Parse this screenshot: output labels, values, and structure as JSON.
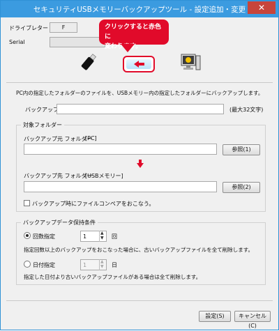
{
  "window": {
    "title": "セキュリティUSBメモリーバックアップツール - 設定追加・変更",
    "close": "✕"
  },
  "top": {
    "drive_letter_label": "ドライブレター",
    "drive_letter_value": "F",
    "serial_label": "Serial"
  },
  "callout": {
    "line1": "クリックすると赤色に",
    "line2": "変わります。"
  },
  "desc": "PC内の指定したフォルダーのファイルを、USBメモリー内の指定したフォルダーにバックアップします。",
  "backup_name": {
    "label": "バックアップ名",
    "value": "",
    "limit": "(最大32文字)"
  },
  "target": {
    "title": "対象フォルダー",
    "source_label": "バックアップ元 フォルダー",
    "source_tag": "[PC]",
    "source_value": "",
    "browse1": "参照(1)",
    "dest_label": "バックアップ先 フォルダー",
    "dest_tag": "[USBメモリー]",
    "dest_value": "",
    "browse2": "参照(2)",
    "compare_label": "バックアップ時にファイルコンペアをおこなう。"
  },
  "retention": {
    "title": "バックアップデータ保持条件",
    "count_label": "回数指定",
    "count_value": "1",
    "count_unit": "回",
    "count_desc": "指定回数以上のバックアップをおこなった場合に、古いバックアップファイルを全て削除します。",
    "date_label": "日付指定",
    "date_value": "1",
    "date_unit": "日",
    "date_desc": "指定した日付より古いバックアップファイルがある場合は全て削除します。"
  },
  "buttons": {
    "ok": "設定(S)",
    "cancel": "キャンセル(C)"
  },
  "colors": {
    "accent": "#3b9be0",
    "highlight": "#e10a2a"
  }
}
